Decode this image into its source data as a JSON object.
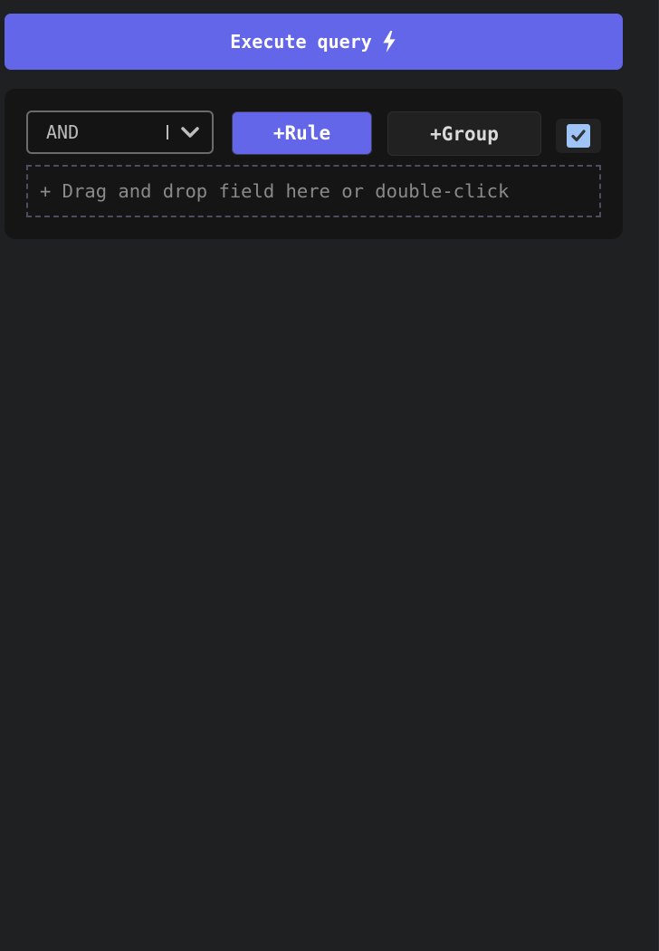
{
  "toolbar": {
    "execute_label": "Execute query",
    "execute_icon": "lightning-bolt-icon",
    "accent_color": "#6366e9"
  },
  "query_group": {
    "conjunction": {
      "selected": "AND",
      "icon": "chevron-down-icon"
    },
    "add_rule_label": "+Rule",
    "add_group_label": "+Group",
    "enabled_checkbox": {
      "checked": true,
      "icon": "checkmark-icon"
    },
    "dropzone_text": "+ Drag and drop field here or double-click"
  }
}
